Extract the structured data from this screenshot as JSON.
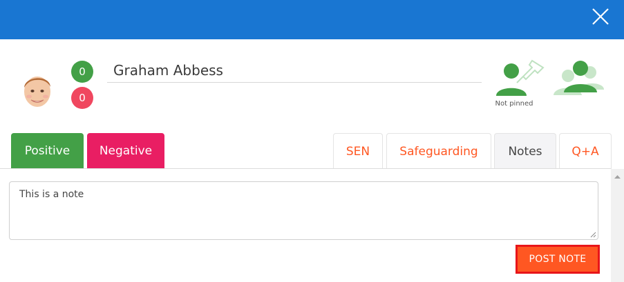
{
  "header": {
    "close_icon": "close-icon"
  },
  "student": {
    "name": "Graham Abbess",
    "positive_count": "0",
    "negative_count": "0",
    "avatar_icon": "student-avatar"
  },
  "pin": {
    "label": "Not pinned",
    "icon": "pin-person-icon"
  },
  "group": {
    "icon": "group-icon"
  },
  "tabs": {
    "positive": "Positive",
    "negative": "Negative",
    "sen": "SEN",
    "safeguarding": "Safeguarding",
    "notes": "Notes",
    "qa": "Q+A"
  },
  "note": {
    "text": "This is a note"
  },
  "actions": {
    "post_note": "POST NOTE"
  },
  "colors": {
    "header_blue": "#1976d2",
    "positive_green": "#43a047",
    "negative_pink": "#e91e63",
    "negative_badge": "#f0475f",
    "accent_orange": "#ff5722",
    "highlight_red": "#e8151a"
  }
}
